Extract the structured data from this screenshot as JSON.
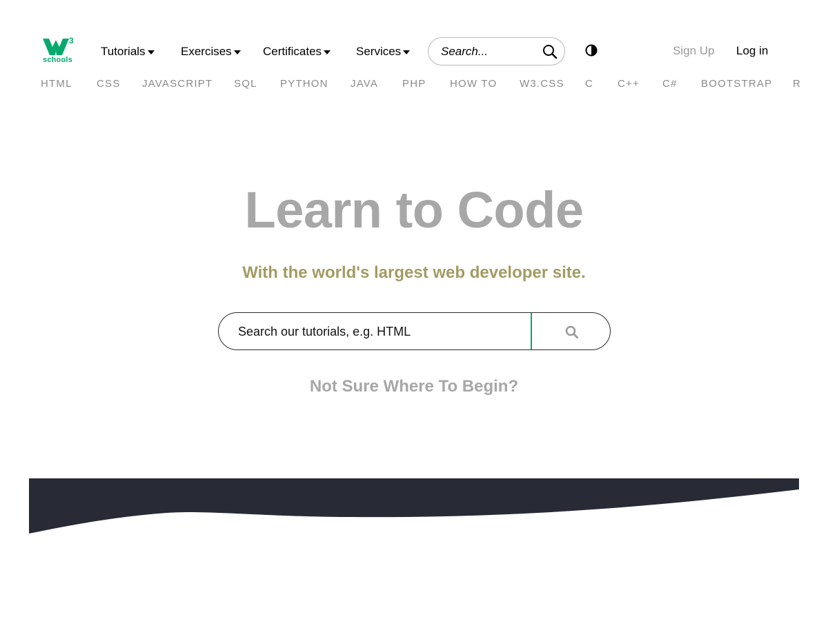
{
  "brand": {
    "logo_mark": "W",
    "logo_superscript": "3",
    "logo_text": "schools",
    "accent_color": "#04AA6D"
  },
  "topnav": {
    "menus": [
      {
        "label": "Tutorials",
        "icon": "caret-down-icon"
      },
      {
        "label": "Exercises",
        "icon": "caret-down-icon"
      },
      {
        "label": "Certificates",
        "icon": "caret-down-icon"
      },
      {
        "label": "Services",
        "icon": "caret-down-icon"
      }
    ],
    "search": {
      "placeholder": "Search...",
      "value": "",
      "icon": "search-icon"
    },
    "contrast_icon": "contrast-toggle-icon",
    "signup_label": "Sign Up",
    "login_label": "Log in"
  },
  "subnav": {
    "items": [
      "HTML",
      "CSS",
      "JAVASCRIPT",
      "SQL",
      "PYTHON",
      "JAVA",
      "PHP",
      "HOW TO",
      "W3.CSS",
      "C",
      "C++",
      "C#",
      "BOOTSTRAP",
      "R"
    ]
  },
  "hero": {
    "title": "Learn to Code",
    "subtitle": "With the world's largest web developer site.",
    "search": {
      "placeholder": "Search our tutorials, e.g. HTML",
      "value": "",
      "icon": "search-icon"
    },
    "cta": "Not Sure Where To Begin?",
    "colors": {
      "title": "#a7a7a7",
      "subtitle": "#a39b63",
      "band": "#282a35"
    }
  }
}
